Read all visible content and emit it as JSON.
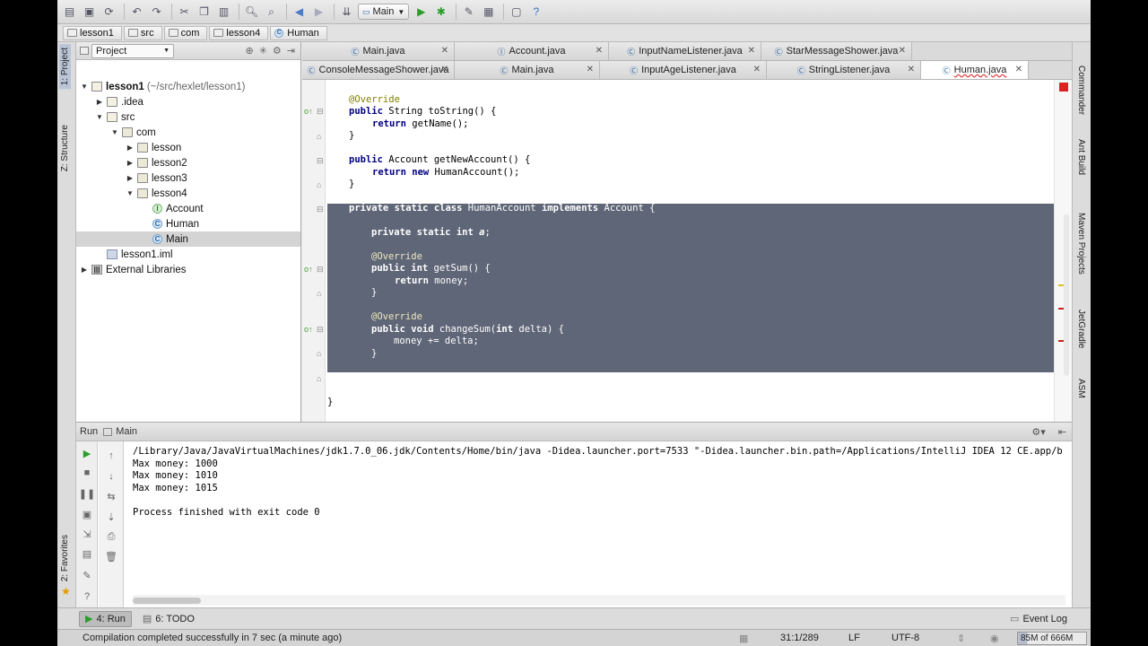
{
  "toolbar": {
    "run_config": "Main",
    "icons": [
      "open-icon",
      "save-icon",
      "sync-icon",
      "undo-icon",
      "redo-icon",
      "cut-icon",
      "copy-icon",
      "paste-icon",
      "find-icon",
      "replace-icon",
      "back-icon",
      "forward-icon",
      "make-icon",
      "run-icon",
      "debug-icon",
      "settings-icon",
      "structure-icon",
      "sdk-icon",
      "help-icon"
    ]
  },
  "breadcrumbs": [
    "lesson1",
    "src",
    "com",
    "lesson4",
    "Human"
  ],
  "left_strip": {
    "project": "1: Project",
    "structure": "Z: Structure",
    "favorites": "2: Favorites"
  },
  "right_strip": [
    "Commander",
    "Ant Build",
    "Maven Projects",
    "JetGradle",
    "ASM"
  ],
  "project_panel": {
    "selector": "Project",
    "tree": [
      {
        "label": "lesson1",
        "extra": "(~/src/hexlet/lesson1)",
        "indent": 0,
        "icon": "folder",
        "expanded": true
      },
      {
        "label": ".idea",
        "indent": 1,
        "icon": "folder",
        "expanded": false
      },
      {
        "label": "src",
        "indent": 1,
        "icon": "folder",
        "expanded": true
      },
      {
        "label": "com",
        "indent": 2,
        "icon": "pkg",
        "expanded": true
      },
      {
        "label": "lesson",
        "indent": 3,
        "icon": "pkg",
        "expanded": false
      },
      {
        "label": "lesson2",
        "indent": 3,
        "icon": "pkg",
        "expanded": false
      },
      {
        "label": "lesson3",
        "indent": 3,
        "icon": "pkg",
        "expanded": false
      },
      {
        "label": "lesson4",
        "indent": 3,
        "icon": "pkg",
        "expanded": true
      },
      {
        "label": "Account",
        "indent": 4,
        "icon": "intf"
      },
      {
        "label": "Human",
        "indent": 4,
        "icon": "cls"
      },
      {
        "label": "Main",
        "indent": 4,
        "icon": "cls",
        "selected": true
      },
      {
        "label": "lesson1.iml",
        "indent": 1,
        "icon": "iml"
      },
      {
        "label": "External Libraries",
        "indent": 0,
        "icon": "lib",
        "expanded": false
      }
    ]
  },
  "editor_tabs": {
    "row1": [
      "Main.java",
      "Account.java",
      "InputNameListener.java",
      "StarMessageShower.java"
    ],
    "row2": [
      "ConsoleMessageShower.java",
      "Main.java",
      "InputAgeListener.java",
      "StringListener.java",
      "Human.java"
    ]
  },
  "code": {
    "l1": "@Override",
    "l2a": "public",
    "l2b": " String toString() {",
    "l3a": "return",
    "l3b": " getName();",
    "l4": "}",
    "l5a": "public",
    "l5b": " Account getNewAccount() {",
    "l6a": "return",
    "l6b": "new",
    "l6c": " HumanAccount();",
    "l7": "}",
    "l8a": "private static class",
    "l8b": " HumanAccount ",
    "l8c": "implements",
    "l8d": " Account {",
    "l9a": "private static int",
    "l9b": "a",
    "l10": "@Override",
    "l11a": "public int",
    "l11b": " getSum() {",
    "l12a": "return",
    "l12b": " money;",
    "l13": "}",
    "l14": "@Override",
    "l15a": "public void",
    "l15b": " changeSum(",
    "l15c": "int",
    "l15d": " delta) {",
    "l16": "money += delta;",
    "l17": "}",
    "l18": "}",
    "l19": "}"
  },
  "run_panel": {
    "title": "Run",
    "config": "Main",
    "console": [
      "/Library/Java/JavaVirtualMachines/jdk1.7.0_06.jdk/Contents/Home/bin/java -Didea.launcher.port=7533 \"-Didea.launcher.bin.path=/Applications/IntelliJ IDEA 12 CE.app/b",
      "Max money: 1000",
      "Max money: 1010",
      "Max money: 1015",
      "",
      "Process finished with exit code 0"
    ]
  },
  "bottom_tabs": {
    "run": "4: Run",
    "todo": "6: TODO",
    "event_log": "Event Log"
  },
  "status": {
    "message": "Compilation completed successfully in 7 sec (a minute ago)",
    "position": "31:1/289",
    "line_sep": "LF",
    "encoding": "UTF-8",
    "memory": "85M of 666M"
  }
}
